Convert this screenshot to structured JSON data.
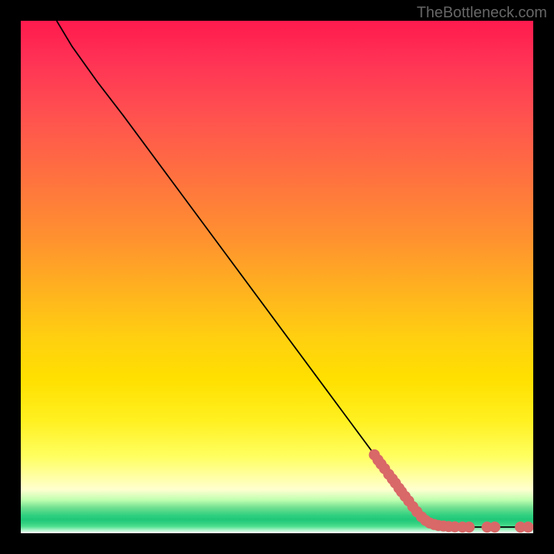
{
  "watermark": "TheBottleneck.com",
  "chart_data": {
    "type": "line",
    "title": "",
    "xlabel": "",
    "ylabel": "",
    "xlim": [
      0,
      100
    ],
    "ylim": [
      0,
      100
    ],
    "curve": [
      {
        "x": 7,
        "y": 100
      },
      {
        "x": 10,
        "y": 95
      },
      {
        "x": 15,
        "y": 88
      },
      {
        "x": 20,
        "y": 81.5
      },
      {
        "x": 30,
        "y": 68
      },
      {
        "x": 40,
        "y": 54.5
      },
      {
        "x": 50,
        "y": 41
      },
      {
        "x": 60,
        "y": 27.5
      },
      {
        "x": 70,
        "y": 14
      },
      {
        "x": 78,
        "y": 3.5
      },
      {
        "x": 80,
        "y": 2
      },
      {
        "x": 82,
        "y": 1.4
      },
      {
        "x": 85,
        "y": 1.2
      },
      {
        "x": 90,
        "y": 1.2
      },
      {
        "x": 95,
        "y": 1.2
      },
      {
        "x": 100,
        "y": 1.2
      }
    ],
    "markers": [
      {
        "x": 69,
        "y": 15.3
      },
      {
        "x": 69.7,
        "y": 14.3
      },
      {
        "x": 70.3,
        "y": 13.5
      },
      {
        "x": 71,
        "y": 12.6
      },
      {
        "x": 71.8,
        "y": 11.5
      },
      {
        "x": 72.5,
        "y": 10.6
      },
      {
        "x": 73.1,
        "y": 9.8
      },
      {
        "x": 73.8,
        "y": 8.8
      },
      {
        "x": 74.3,
        "y": 8.1
      },
      {
        "x": 75,
        "y": 7.2
      },
      {
        "x": 75.7,
        "y": 6.3
      },
      {
        "x": 76.5,
        "y": 5.2
      },
      {
        "x": 77.3,
        "y": 4.2
      },
      {
        "x": 78.2,
        "y": 3.2
      },
      {
        "x": 79,
        "y": 2.5
      },
      {
        "x": 79.8,
        "y": 2
      },
      {
        "x": 80.7,
        "y": 1.7
      },
      {
        "x": 81.5,
        "y": 1.5
      },
      {
        "x": 82.5,
        "y": 1.4
      },
      {
        "x": 83.5,
        "y": 1.3
      },
      {
        "x": 84.7,
        "y": 1.25
      },
      {
        "x": 86.2,
        "y": 1.2
      },
      {
        "x": 87.5,
        "y": 1.2
      },
      {
        "x": 91,
        "y": 1.2
      },
      {
        "x": 92.5,
        "y": 1.2
      },
      {
        "x": 97.5,
        "y": 1.2
      },
      {
        "x": 99,
        "y": 1.2
      }
    ],
    "colors": {
      "curve": "#000000",
      "marker": "#d96868"
    }
  }
}
